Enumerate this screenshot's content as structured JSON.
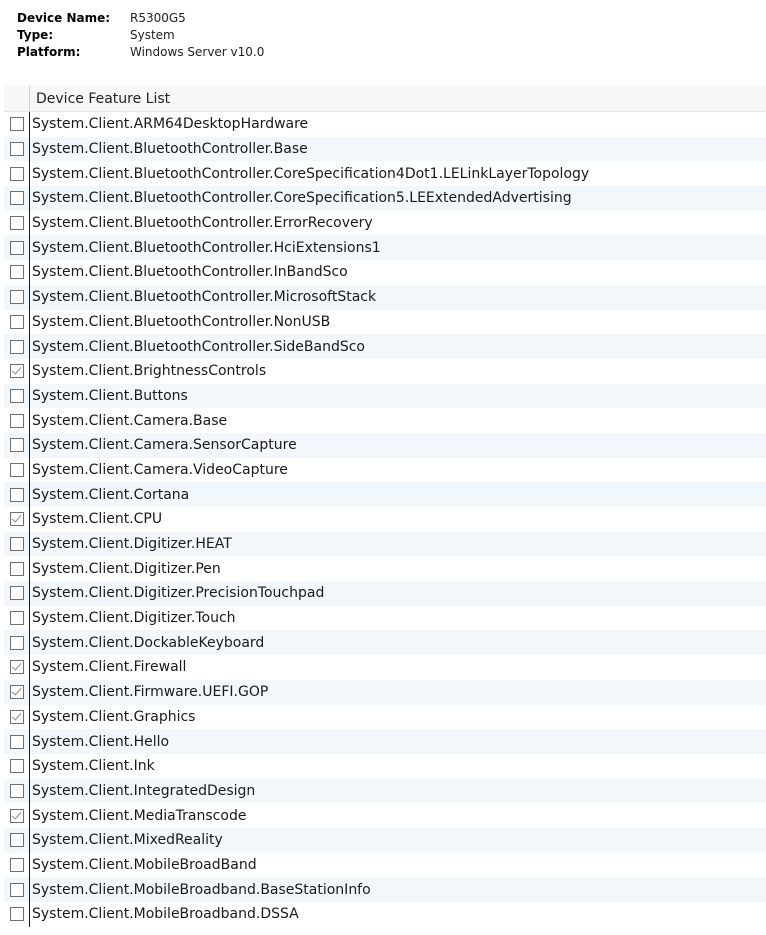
{
  "device_info": {
    "name_label": "Device Name:",
    "name_value": "R5300G5",
    "type_label": "Type:",
    "type_value": "System",
    "platform_label": "Platform:",
    "platform_value": "Windows Server v10.0"
  },
  "feature_list": {
    "header": "Device Feature List",
    "items": [
      {
        "label": "System.Client.ARM64DesktopHardware",
        "checked": false
      },
      {
        "label": "System.Client.BluetoothController.Base",
        "checked": false
      },
      {
        "label": "System.Client.BluetoothController.CoreSpecification4Dot1.LELinkLayerTopology",
        "checked": false
      },
      {
        "label": "System.Client.BluetoothController.CoreSpecification5.LEExtendedAdvertising",
        "checked": false
      },
      {
        "label": "System.Client.BluetoothController.ErrorRecovery",
        "checked": false
      },
      {
        "label": "System.Client.BluetoothController.HciExtensions1",
        "checked": false
      },
      {
        "label": "System.Client.BluetoothController.InBandSco",
        "checked": false
      },
      {
        "label": "System.Client.BluetoothController.MicrosoftStack",
        "checked": false
      },
      {
        "label": "System.Client.BluetoothController.NonUSB",
        "checked": false
      },
      {
        "label": "System.Client.BluetoothController.SideBandSco",
        "checked": false
      },
      {
        "label": "System.Client.BrightnessControls",
        "checked": true
      },
      {
        "label": "System.Client.Buttons",
        "checked": false
      },
      {
        "label": "System.Client.Camera.Base",
        "checked": false
      },
      {
        "label": "System.Client.Camera.SensorCapture",
        "checked": false
      },
      {
        "label": "System.Client.Camera.VideoCapture",
        "checked": false
      },
      {
        "label": "System.Client.Cortana",
        "checked": false
      },
      {
        "label": "System.Client.CPU",
        "checked": true
      },
      {
        "label": "System.Client.Digitizer.HEAT",
        "checked": false
      },
      {
        "label": "System.Client.Digitizer.Pen",
        "checked": false
      },
      {
        "label": "System.Client.Digitizer.PrecisionTouchpad",
        "checked": false
      },
      {
        "label": "System.Client.Digitizer.Touch",
        "checked": false
      },
      {
        "label": "System.Client.DockableKeyboard",
        "checked": false
      },
      {
        "label": "System.Client.Firewall",
        "checked": true
      },
      {
        "label": "System.Client.Firmware.UEFI.GOP",
        "checked": true
      },
      {
        "label": "System.Client.Graphics",
        "checked": true
      },
      {
        "label": "System.Client.Hello",
        "checked": false
      },
      {
        "label": "System.Client.Ink",
        "checked": false
      },
      {
        "label": "System.Client.IntegratedDesign",
        "checked": false
      },
      {
        "label": "System.Client.MediaTranscode",
        "checked": true
      },
      {
        "label": "System.Client.MixedReality",
        "checked": false
      },
      {
        "label": "System.Client.MobileBroadBand",
        "checked": false
      },
      {
        "label": "System.Client.MobileBroadband.BaseStationInfo",
        "checked": false
      },
      {
        "label": "System.Client.MobileBroadband.DSSA",
        "checked": false
      }
    ]
  }
}
